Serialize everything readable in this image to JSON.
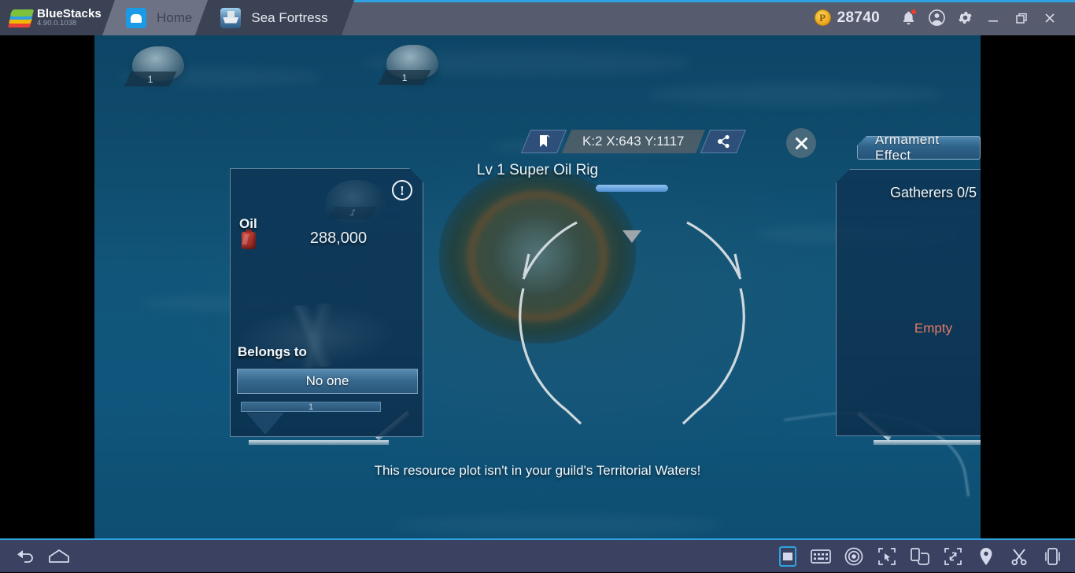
{
  "titlebar": {
    "brand_name": "BlueStacks",
    "brand_version": "4.90.0.1038",
    "brand_logo_icon": "bluestacks-logo-icon",
    "tabs": [
      {
        "label": "Home",
        "icon": "home-icon",
        "active": false
      },
      {
        "label": "Sea Fortress",
        "icon": "sea-fortress-app-icon",
        "active": true
      }
    ],
    "points": {
      "value": "28740",
      "icon": "bluestacks-points-coin-icon"
    },
    "actions": [
      {
        "name": "notifications-bell-icon",
        "glyph": "bell",
        "badge": true
      },
      {
        "name": "user-account-icon",
        "glyph": "account"
      },
      {
        "name": "settings-gear-icon",
        "glyph": "gear"
      },
      {
        "name": "minimize-button",
        "glyph": "minimize"
      },
      {
        "name": "restore-button",
        "glyph": "restore"
      },
      {
        "name": "close-button",
        "glyph": "close"
      }
    ]
  },
  "game": {
    "coord_flag_icon": "bookmark-flag-icon",
    "coordinates": "K:2 X:643 Y:1117",
    "route_icon": "share-route-icon",
    "close_icon": "close-x-icon",
    "plot_title": "Lv 1 Super Oil Rig",
    "notice": "This resource plot isn't in your guild's Territorial Waters!",
    "islands": [
      {
        "level": "1"
      },
      {
        "level": "1"
      }
    ],
    "left_panel": {
      "info_icon": "info-exclamation-icon",
      "resource_label": "Oil",
      "resource_icon": "oil-canister-icon",
      "resource_amount": "288,000",
      "belongs_label": "Belongs to",
      "owner_value": "No one",
      "owner_bar_value": "1",
      "art_island_level": "1"
    },
    "right_panel": {
      "tab_label": "Armament Effect",
      "gatherers": "Gatherers 0/5",
      "empty_text": "Empty"
    }
  },
  "bottombar": {
    "left": [
      {
        "name": "android-back-icon"
      },
      {
        "name": "android-home-icon"
      }
    ],
    "right": [
      {
        "name": "portrait-mode-icon",
        "selected": true
      },
      {
        "name": "keyboard-controls-icon"
      },
      {
        "name": "eye-macro-icon"
      },
      {
        "name": "cursor-select-icon"
      },
      {
        "name": "rotate-screen-icon"
      },
      {
        "name": "fullscreen-icon"
      },
      {
        "name": "location-pin-icon"
      },
      {
        "name": "scissors-trim-icon"
      },
      {
        "name": "shake-device-icon"
      }
    ]
  },
  "colors": {
    "accent": "#2ea3e0",
    "titlebar_bg": "#565b6e",
    "tab_active_bg": "#3b4254",
    "bottombar_bg": "#3b4160",
    "empty_text": "#e57a63",
    "water": "#11567a"
  }
}
